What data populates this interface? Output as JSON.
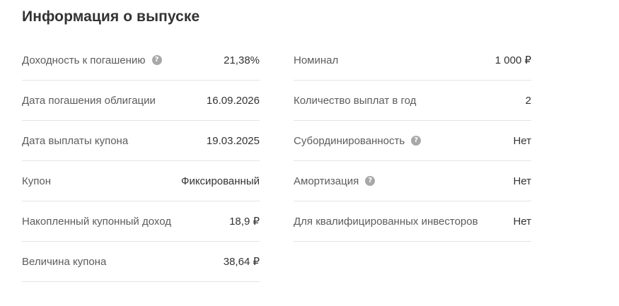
{
  "title": "Информация о выпуске",
  "help_glyph": "?",
  "colors": {
    "text": "#333333",
    "label": "#5c5c5c",
    "divider": "#e4e4e4",
    "help_icon": "#a8a8a8"
  },
  "left": [
    {
      "label": "Доходность к погашению",
      "value": "21,38%",
      "help": true
    },
    {
      "label": "Дата погашения облигации",
      "value": "16.09.2026",
      "help": false
    },
    {
      "label": "Дата выплаты купона",
      "value": "19.03.2025",
      "help": false
    },
    {
      "label": "Купон",
      "value": "Фиксированный",
      "help": false
    },
    {
      "label": "Накопленный купонный доход",
      "value": "18,9 ₽",
      "help": false
    },
    {
      "label": "Величина купона",
      "value": "38,64 ₽",
      "help": false
    }
  ],
  "right": [
    {
      "label": "Номинал",
      "value": "1 000 ₽",
      "help": false
    },
    {
      "label": "Количество выплат в год",
      "value": "2",
      "help": false
    },
    {
      "label": "Субординированность",
      "value": "Нет",
      "help": true
    },
    {
      "label": "Амортизация",
      "value": "Нет",
      "help": true
    },
    {
      "label": "Для квалифицированных инвесторов",
      "value": "Нет",
      "help": false
    }
  ]
}
